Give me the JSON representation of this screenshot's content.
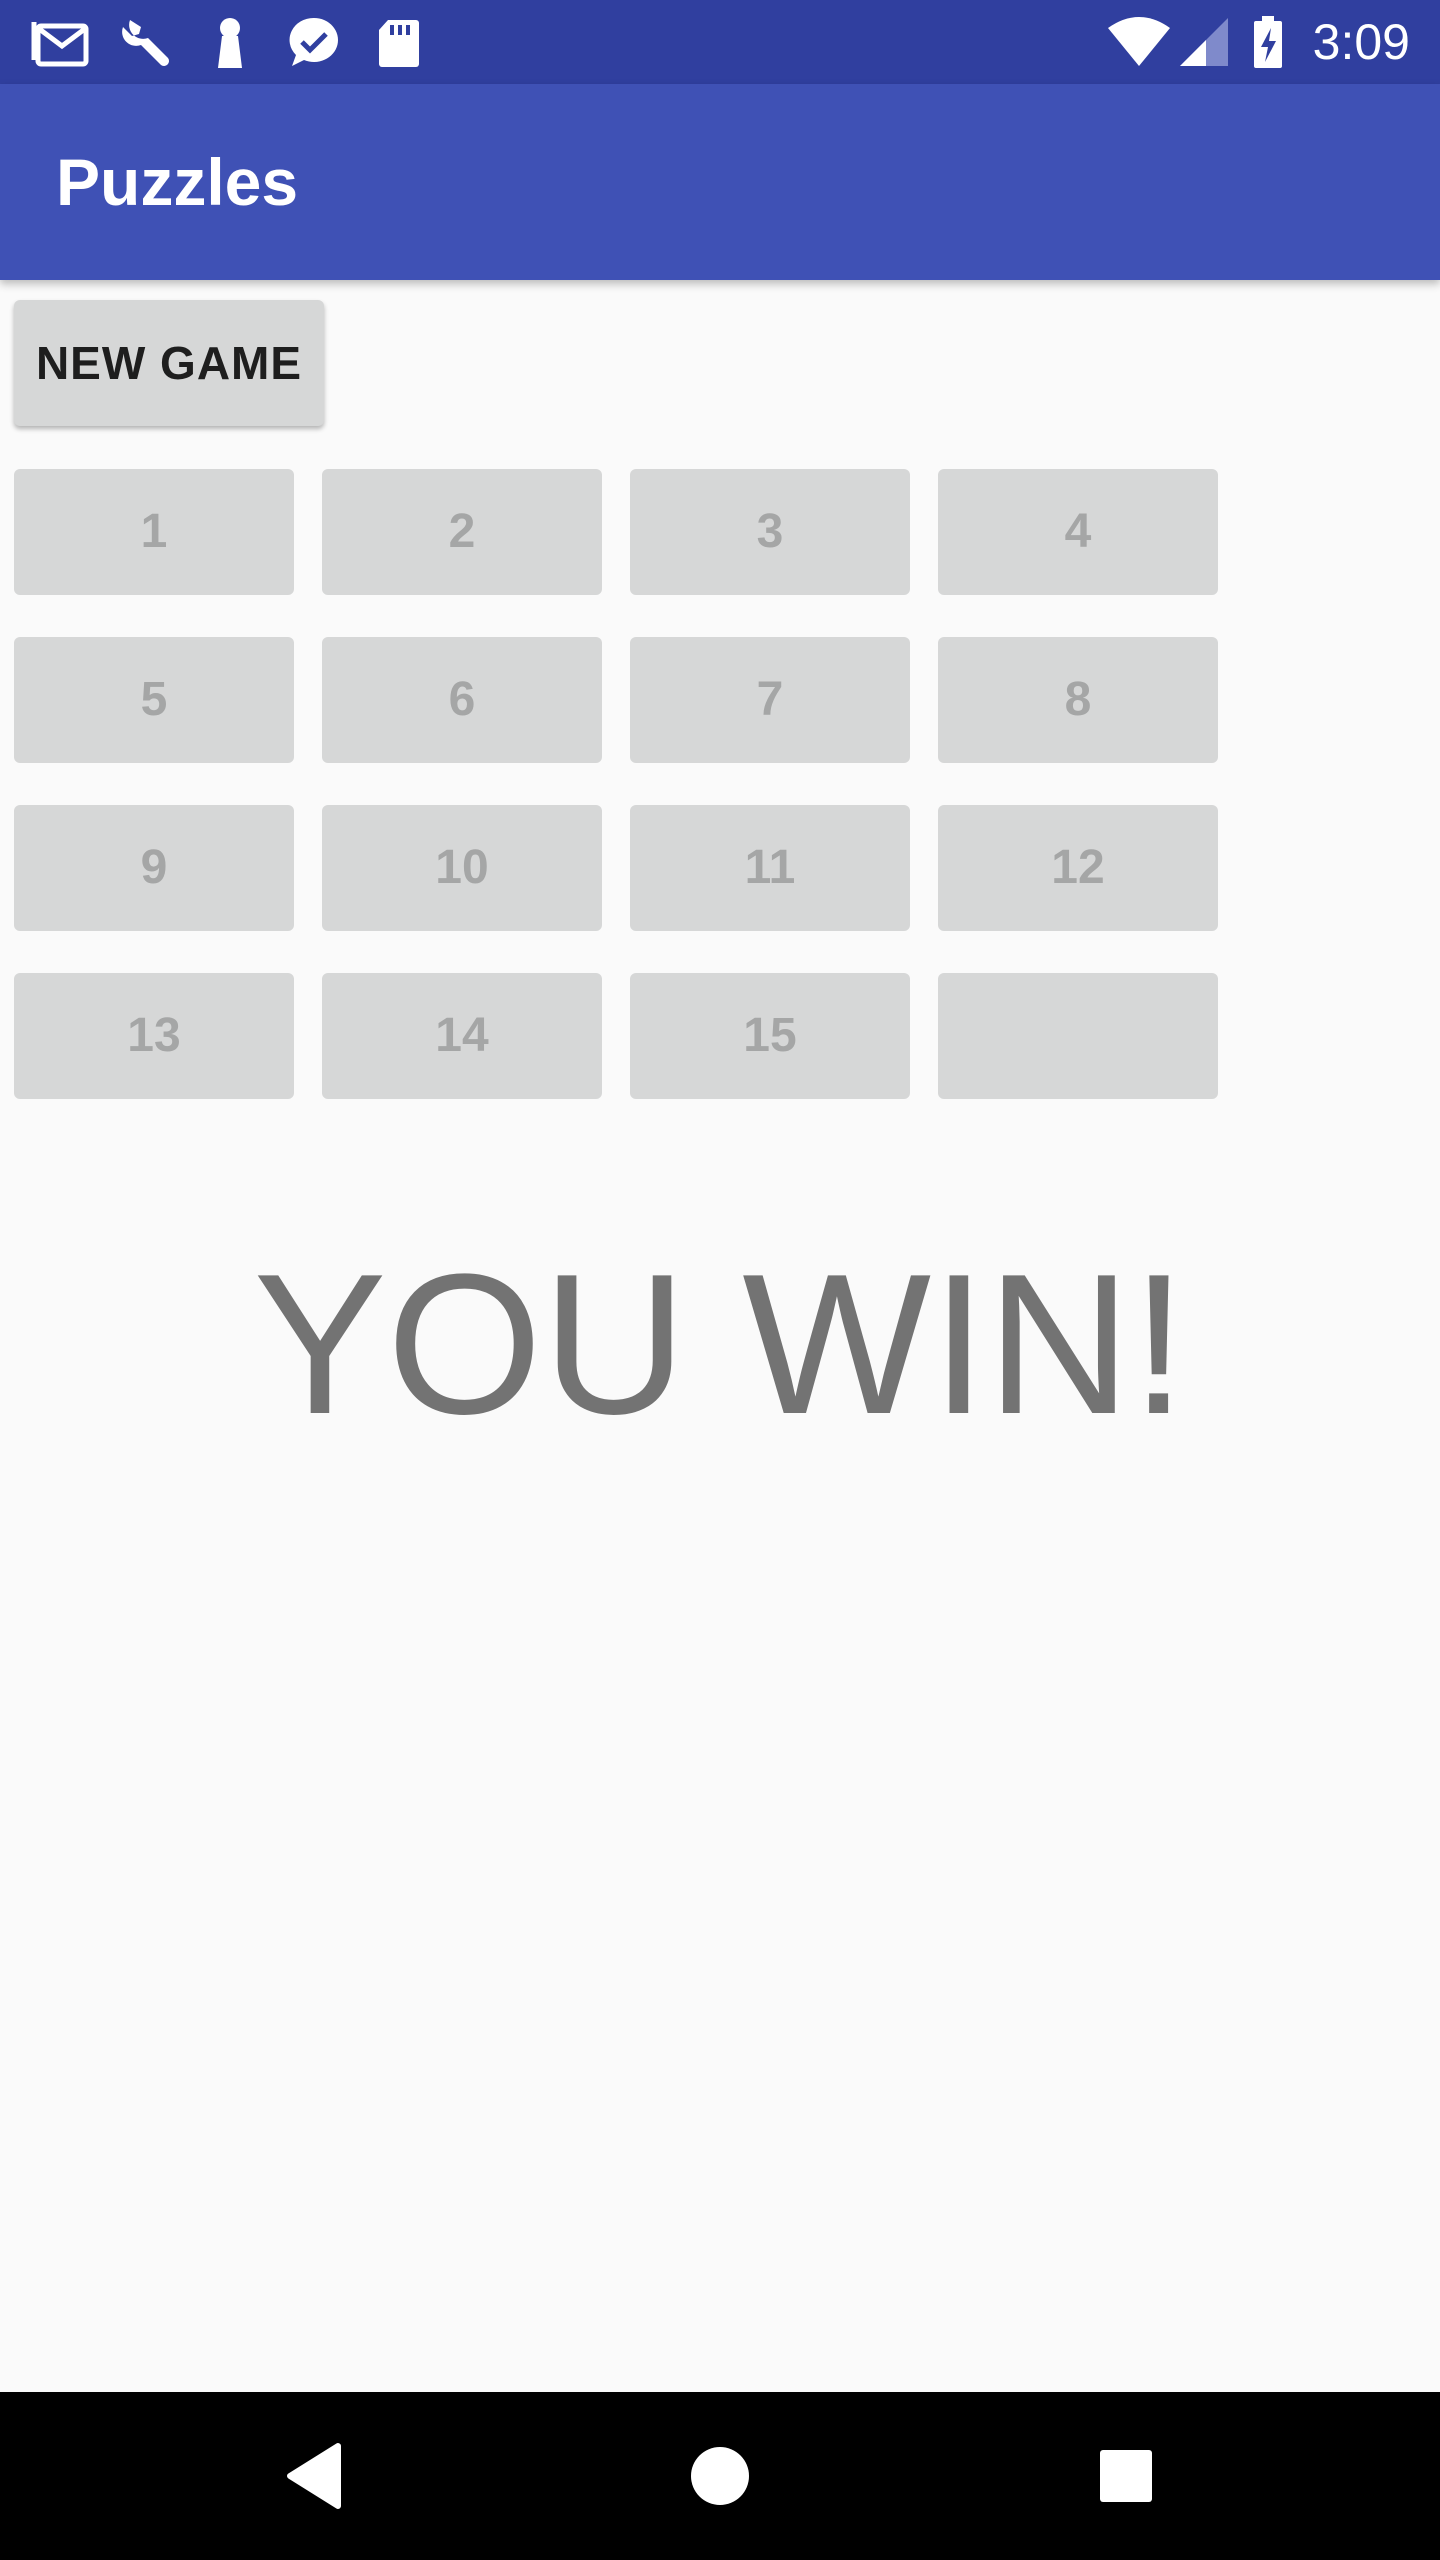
{
  "status_bar": {
    "time": "3:09",
    "icons": [
      "gmail-icon",
      "wrench-icon",
      "keyhole-icon",
      "messenger-icon",
      "sd-card-icon",
      "wifi-icon",
      "signal-icon",
      "battery-charging-icon"
    ],
    "background": "#303f9f"
  },
  "app_bar": {
    "title": "Puzzles",
    "background": "#3f51b5"
  },
  "controls": {
    "new_game_label": "NEW GAME"
  },
  "board": {
    "tiles": [
      "1",
      "2",
      "3",
      "4",
      "5",
      "6",
      "7",
      "8",
      "9",
      "10",
      "11",
      "12",
      "13",
      "14",
      "15",
      ""
    ],
    "tile_color": "#d6d7d7",
    "tile_text_color": "#a5a6a6"
  },
  "message": {
    "text": "YOU WIN!",
    "color": "#737373"
  },
  "nav_bar": {
    "buttons": [
      "back-icon",
      "home-icon",
      "recents-icon"
    ]
  }
}
